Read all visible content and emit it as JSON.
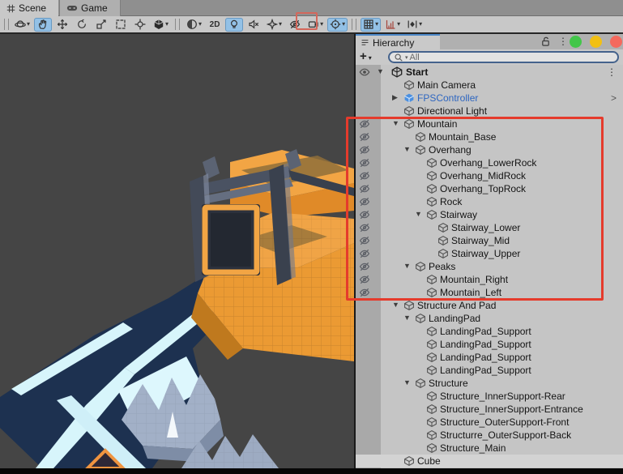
{
  "scene_tabs": [
    {
      "label": "Scene",
      "active": true
    },
    {
      "label": "Game",
      "active": false
    }
  ],
  "toolbar": {
    "groups": [
      [
        {
          "name": "view-tool",
          "icon": "orbit",
          "dropdown": true
        },
        {
          "name": "hand-tool",
          "icon": "hand",
          "selected": true
        },
        {
          "name": "move-tool",
          "icon": "move"
        },
        {
          "name": "rotate-tool",
          "icon": "rotate"
        },
        {
          "name": "scale-tool",
          "icon": "scale"
        },
        {
          "name": "rect-tool",
          "icon": "rect"
        },
        {
          "name": "transform-tool",
          "icon": "transform"
        },
        {
          "name": "custom-editor-tool",
          "icon": "unity",
          "dropdown": true
        }
      ],
      [
        {
          "name": "render-mode",
          "icon": "sphere",
          "dropdown": true
        },
        {
          "name": "mode-2d",
          "label": "2D"
        },
        {
          "name": "scene-lighting",
          "icon": "bulb",
          "selected": true
        },
        {
          "name": "scene-audio",
          "icon": "audio"
        },
        {
          "name": "effects",
          "icon": "sparkle",
          "dropdown": true
        },
        {
          "name": "hidden-objects",
          "icon": "eyeoff",
          "boxed": true
        },
        {
          "name": "scene-camera",
          "icon": "camera",
          "dropdown": true
        },
        {
          "name": "gizmos",
          "icon": "gizmo",
          "selected": true,
          "dropdown": true
        }
      ],
      [
        {
          "name": "grid-snap",
          "icon": "grid",
          "selected": true,
          "dropdown": true
        },
        {
          "name": "increment-snap",
          "icon": "snap",
          "dropdown": true
        },
        {
          "name": "camera-bookmarks",
          "icon": "keyframe",
          "dropdown": true
        }
      ]
    ]
  },
  "hierarchy": {
    "tab_label": "Hierarchy",
    "create_button": "+",
    "search_placeholder": "All",
    "scene_row": {
      "label": "Start"
    },
    "window_dots": [
      "#43c64a",
      "#f2c013",
      "#f4695d"
    ],
    "rows": [
      {
        "label": "Main Camera",
        "depth": 1,
        "icon": "cube"
      },
      {
        "label": "FPSController",
        "depth": 1,
        "icon": "cube-prefab",
        "arrow": "collapsed",
        "prefab": true,
        "chevron": ">"
      },
      {
        "label": "Directional Light",
        "depth": 1,
        "icon": "cube"
      },
      {
        "label": "Mountain",
        "depth": 1,
        "icon": "cube",
        "arrow": "expanded",
        "hidden": true
      },
      {
        "label": "Mountain_Base",
        "depth": 2,
        "icon": "cube",
        "hidden": true
      },
      {
        "label": "Overhang",
        "depth": 2,
        "icon": "cube",
        "arrow": "expanded",
        "hidden": true
      },
      {
        "label": "Overhang_LowerRock",
        "depth": 3,
        "icon": "cube",
        "hidden": true
      },
      {
        "label": "Overhang_MidRock",
        "depth": 3,
        "icon": "cube",
        "hidden": true
      },
      {
        "label": "Overhang_TopRock",
        "depth": 3,
        "icon": "cube",
        "hidden": true
      },
      {
        "label": "Rock",
        "depth": 3,
        "icon": "cube",
        "hidden": true
      },
      {
        "label": "Stairway",
        "depth": 3,
        "icon": "cube",
        "arrow": "expanded",
        "hidden": true
      },
      {
        "label": "Stairway_Lower",
        "depth": 4,
        "icon": "cube",
        "hidden": true
      },
      {
        "label": "Stairway_Mid",
        "depth": 4,
        "icon": "cube",
        "hidden": true
      },
      {
        "label": "Stairway_Upper",
        "depth": 4,
        "icon": "cube",
        "hidden": true
      },
      {
        "label": "Peaks",
        "depth": 2,
        "icon": "cube",
        "arrow": "expanded",
        "hidden": true
      },
      {
        "label": "Mountain_Right",
        "depth": 3,
        "icon": "cube",
        "hidden": true
      },
      {
        "label": "Mountain_Left",
        "depth": 3,
        "icon": "cube",
        "hidden": true
      },
      {
        "label": "Structure And Pad",
        "depth": 1,
        "icon": "cube",
        "arrow": "expanded"
      },
      {
        "label": "LandingPad",
        "depth": 2,
        "icon": "cube",
        "arrow": "expanded"
      },
      {
        "label": "LandingPad_Support",
        "depth": 3,
        "icon": "cube"
      },
      {
        "label": "LandingPad_Support",
        "depth": 3,
        "icon": "cube"
      },
      {
        "label": "LandingPad_Support",
        "depth": 3,
        "icon": "cube"
      },
      {
        "label": "LandingPad_Support",
        "depth": 3,
        "icon": "cube"
      },
      {
        "label": "Structure",
        "depth": 2,
        "icon": "cube",
        "arrow": "expanded"
      },
      {
        "label": "Structure_InnerSupport-Rear",
        "depth": 3,
        "icon": "cube"
      },
      {
        "label": "Structure_InnerSupport-Entrance",
        "depth": 3,
        "icon": "cube"
      },
      {
        "label": "Structure_OuterSupport-Front",
        "depth": 3,
        "icon": "cube"
      },
      {
        "label": "Structurre_OuterSupport-Back",
        "depth": 3,
        "icon": "cube"
      },
      {
        "label": "Structure_Main",
        "depth": 3,
        "icon": "cube"
      },
      {
        "label": "Cube",
        "depth": 1,
        "icon": "cube",
        "highlighted": true
      }
    ]
  },
  "annotations": {
    "toolbar_box_color": "#d4685c",
    "hierarchy_box_color": "#e53b2c"
  },
  "colors": {
    "scene_background": "#454545",
    "terrain_orange": "#f0a446",
    "terrain_navy": "#1d3150",
    "road_stripe_cyan": "#d7f5fb",
    "rock_gray": "#a2b0c7",
    "gate_slate": "#4a5262",
    "prefab_blue": "#2e66c0",
    "selection_blue": "#93c1e6"
  }
}
